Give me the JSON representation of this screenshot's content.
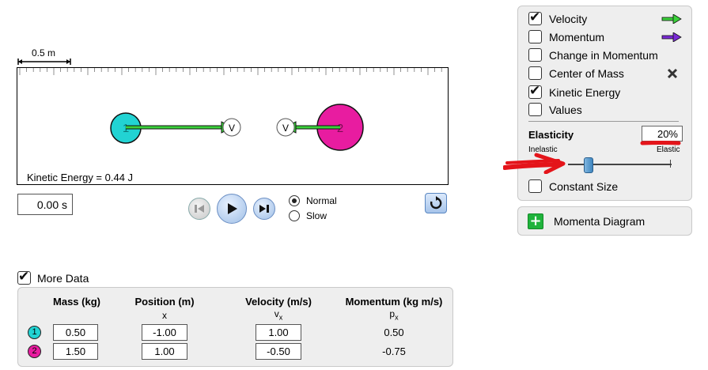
{
  "scale": {
    "label": "0.5 m"
  },
  "sim": {
    "kinetic_energy_text": "Kinetic Energy = 0.44 J",
    "ball1": {
      "label": "1",
      "color": "#22d3d3",
      "vector_label": "V"
    },
    "ball2": {
      "label": "2",
      "color": "#e81ca0",
      "vector_label": "V"
    },
    "velocity_color": "#3ad13a"
  },
  "controls": {
    "time": "0.00 s",
    "speed_options": [
      "Normal",
      "Slow"
    ],
    "speed_selected": "Normal"
  },
  "panel": {
    "options": [
      {
        "label": "Velocity",
        "checked": true,
        "icon": "green-arrow-icon"
      },
      {
        "label": "Momentum",
        "checked": false,
        "icon": "purple-arrow-icon"
      },
      {
        "label": "Change in Momentum",
        "checked": false
      },
      {
        "label": "Center of Mass",
        "checked": false,
        "icon": "x-mark-icon"
      },
      {
        "label": "Kinetic Energy",
        "checked": true
      },
      {
        "label": "Values",
        "checked": false
      }
    ],
    "elasticity_label": "Elasticity",
    "elasticity_value": "20%",
    "elasticity_fraction": 0.2,
    "inelastic_label": "Inelastic",
    "elastic_label": "Elastic",
    "constant_size_label": "Constant Size",
    "constant_size_checked": false
  },
  "momenta": {
    "label": "Momenta Diagram"
  },
  "more_data": {
    "label": "More Data",
    "checked": true,
    "headers": {
      "mass": "Mass (kg)",
      "position": "Position (m)",
      "velocity": "Velocity (m/s)",
      "momentum": "Momentum (kg m/s)"
    },
    "subheaders": {
      "position": "x",
      "velocity": "v",
      "velocity_sub": "x",
      "momentum": "p",
      "momentum_sub": "x"
    },
    "rows": [
      {
        "ball": "1",
        "mass": "0.50",
        "position": "-1.00",
        "velocity": "1.00",
        "momentum": "0.50"
      },
      {
        "ball": "2",
        "mass": "1.50",
        "position": "1.00",
        "velocity": "-0.50",
        "momentum": "-0.75"
      }
    ]
  }
}
